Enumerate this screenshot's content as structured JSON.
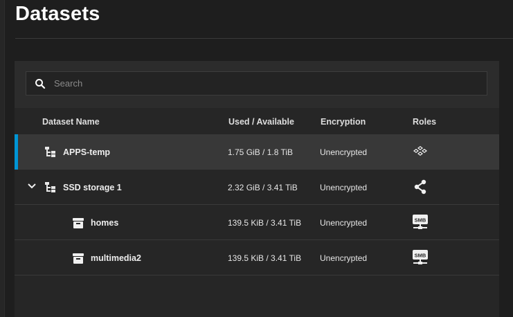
{
  "page": {
    "title": "Datasets"
  },
  "search": {
    "placeholder": "Search",
    "value": ""
  },
  "table": {
    "columns": {
      "name": "Dataset Name",
      "used": "Used / Available",
      "encryption": "Encryption",
      "roles": "Roles"
    },
    "rows": [
      {
        "name": "APPS-temp",
        "used": "1.75 GiB / 1.8 TiB",
        "encryption": "Unencrypted",
        "role_icon": "apps-icon",
        "selected": true,
        "level": 0,
        "expandable": false
      },
      {
        "name": "SSD storage 1",
        "used": "2.32 GiB / 3.41 TiB",
        "encryption": "Unencrypted",
        "role_icon": "share-icon",
        "selected": false,
        "level": 0,
        "expandable": true
      },
      {
        "name": "homes",
        "used": "139.5 KiB / 3.41 TiB",
        "encryption": "Unencrypted",
        "role_icon": "smb-share-icon",
        "selected": false,
        "level": 1,
        "expandable": false
      },
      {
        "name": "multimedia2",
        "used": "139.5 KiB / 3.41 TiB",
        "encryption": "Unencrypted",
        "role_icon": "smb-share-icon",
        "selected": false,
        "level": 1,
        "expandable": false
      }
    ]
  },
  "icons": {
    "smb_label": "SMB"
  },
  "colors": {
    "accent": "#0095d5",
    "background": "#1e1e1e",
    "card": "#262626",
    "selected_row": "#383838"
  }
}
